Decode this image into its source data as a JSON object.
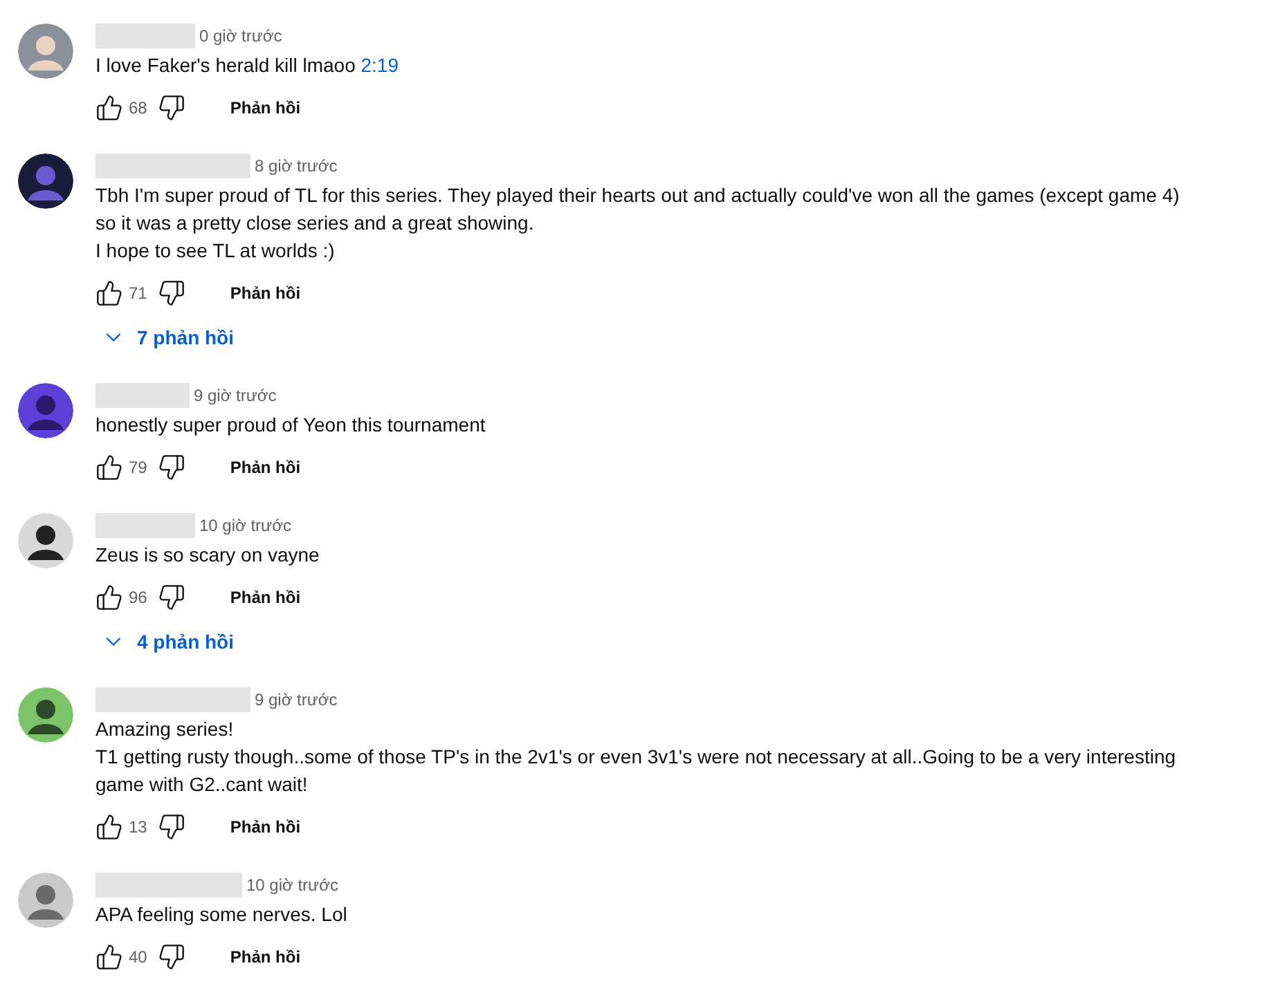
{
  "comments": [
    {
      "time": "0 giờ trước",
      "lines": [
        "I love Faker's herald kill lmaoo"
      ],
      "timestamp_link": "2:19",
      "likes": "68",
      "reply_label": "Phản hồi"
    },
    {
      "time": "8 giờ trước",
      "lines": [
        "Tbh I'm super proud of TL for this series. They played their hearts out and actually could've won all the games (except game 4)",
        "so it was a pretty close series and a great showing.",
        "I hope to see TL at worlds :)"
      ],
      "likes": "71",
      "reply_label": "Phản hồi",
      "replies": "7 phản hồi"
    },
    {
      "time": "9 giờ trước",
      "lines": [
        "honestly super proud of Yeon this tournament"
      ],
      "likes": "79",
      "reply_label": "Phản hồi"
    },
    {
      "time": "10 giờ trước",
      "lines": [
        "Zeus is so scary on vayne"
      ],
      "likes": "96",
      "reply_label": "Phản hồi",
      "replies": "4 phản hồi"
    },
    {
      "time": "9 giờ trước",
      "lines": [
        "Amazing series!",
        "T1 getting rusty though..some of those TP's in the 2v1's or even 3v1's were not necessary at all..Going to be a very interesting",
        "game with G2..cant wait!"
      ],
      "likes": "13",
      "reply_label": "Phản hồi"
    },
    {
      "time": "10 giờ trước",
      "lines": [
        "APA feeling some nerves. Lol"
      ],
      "likes": "40",
      "reply_label": "Phản hồi"
    }
  ]
}
